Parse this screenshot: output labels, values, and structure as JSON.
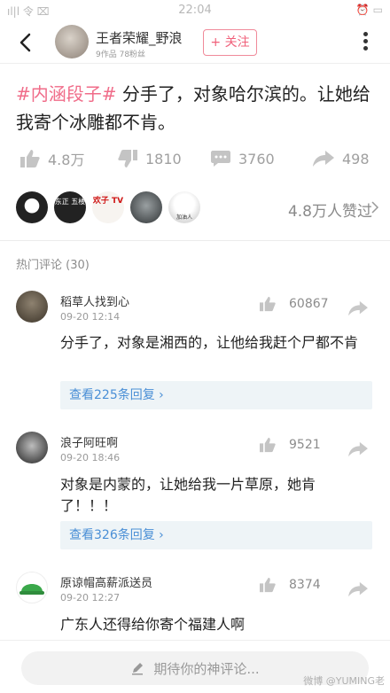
{
  "status": {
    "left": "ıl|l 令 ⌧",
    "time": "22:04",
    "right": "⏰ ▭"
  },
  "header": {
    "author_name": "王者荣耀_野浪",
    "author_meta": "9作品  78粉丝",
    "follow_label": "+ 关注"
  },
  "post": {
    "tag": "#内涵段子#",
    "text": " 分手了，对象哈尔滨的。让她给我寄个冰雕都不肯。"
  },
  "actions": {
    "likes": "4.8万",
    "dislikes": "1810",
    "comments": "3760",
    "shares": "498"
  },
  "likers": {
    "summary": "4.8万人赞过",
    "avatar_texts": [
      "",
      "东正 五楼",
      "欢子 TV",
      "",
      "加油人"
    ]
  },
  "hot_comments": {
    "title": "热门评论 (30)"
  },
  "comments": [
    {
      "user": "稻草人找到心",
      "time": "09-20 12:14",
      "likes": "60867",
      "text": "分手了，对象是湘西的，让他给我赶个尸都不肯",
      "replies": "查看225条回复 ›"
    },
    {
      "user": "浪子阿旺啊",
      "time": "09-20 18:46",
      "likes": "9521",
      "text": "对象是内蒙的，让她给我一片草原，她肯了！！！",
      "replies": "查看326条回复 ›"
    },
    {
      "user": "原谅帽高薪派送员",
      "time": "09-20 12:27",
      "likes": "8374",
      "text": "广东人还得给你寄个福建人啊"
    }
  ],
  "bottom": {
    "placeholder": "期待你的神评论..."
  },
  "watermark": "微博 @YUMING老"
}
